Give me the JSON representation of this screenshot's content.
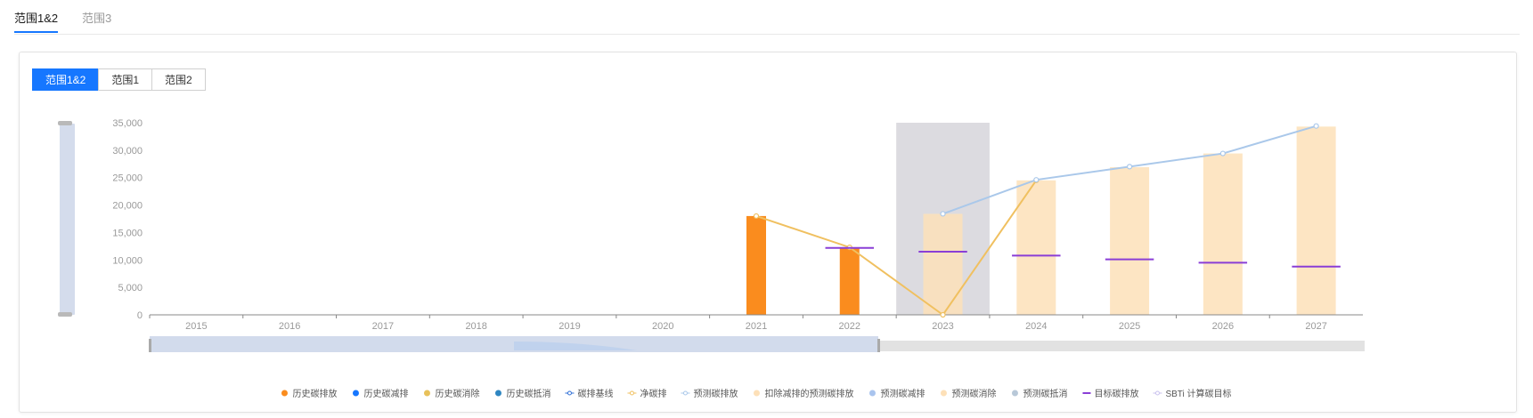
{
  "tabs": [
    {
      "label": "范围1&2",
      "active": true
    },
    {
      "label": "范围3",
      "active": false
    }
  ],
  "segment": [
    {
      "label": "范围1&2",
      "active": true
    },
    {
      "label": "范围1",
      "active": false
    },
    {
      "label": "范围2",
      "active": false
    }
  ],
  "chart_data": {
    "type": "bar",
    "categories": [
      "2015",
      "2016",
      "2017",
      "2018",
      "2019",
      "2020",
      "2021",
      "2022",
      "2023",
      "2024",
      "2025",
      "2026",
      "2027"
    ],
    "ylim": [
      0,
      35000
    ],
    "yticks": [
      "35,000",
      "30,000",
      "25,000",
      "20,000",
      "15,000",
      "10,000",
      "5,000",
      "0"
    ],
    "ytick_values": [
      35000,
      30000,
      25000,
      20000,
      15000,
      10000,
      5000,
      0
    ],
    "highlight_category": "2023",
    "series": [
      {
        "name": "历史碳排放",
        "kind": "bar",
        "color": "#fa8c1e",
        "values": [
          null,
          null,
          null,
          null,
          null,
          null,
          18000,
          12300,
          null,
          null,
          null,
          null,
          null
        ]
      },
      {
        "name": "历史碳减排",
        "kind": "bar",
        "color": "#1677ff",
        "values": [
          null,
          null,
          null,
          null,
          null,
          null,
          null,
          null,
          null,
          null,
          null,
          null,
          null
        ]
      },
      {
        "name": "历史碳消除",
        "kind": "bar",
        "color": "#e8c15a",
        "values": [
          null,
          null,
          null,
          null,
          null,
          null,
          null,
          null,
          null,
          null,
          null,
          null,
          null
        ]
      },
      {
        "name": "历史碳抵消",
        "kind": "bar",
        "color": "#2e86c1",
        "values": [
          null,
          null,
          null,
          null,
          null,
          null,
          null,
          null,
          null,
          null,
          null,
          null,
          null
        ]
      },
      {
        "name": "碳排基线",
        "kind": "line",
        "color": "#2f6fd6",
        "values": [
          null,
          null,
          null,
          null,
          null,
          null,
          null,
          null,
          null,
          null,
          null,
          null,
          null
        ]
      },
      {
        "name": "净碳排",
        "kind": "line",
        "color": "#f0c060",
        "values": [
          null,
          null,
          null,
          null,
          null,
          null,
          18000,
          12300,
          0,
          24500,
          null,
          null,
          null
        ]
      },
      {
        "name": "预测碳排放",
        "kind": "line",
        "color": "#aac8ea",
        "values": [
          null,
          null,
          null,
          null,
          null,
          null,
          null,
          null,
          18400,
          24600,
          27000,
          29400,
          34400
        ]
      },
      {
        "name": "扣除减排的预测碳排放",
        "kind": "bar",
        "color": "#fde0b8",
        "values": [
          null,
          null,
          null,
          null,
          null,
          null,
          null,
          null,
          18400,
          24500,
          26900,
          29400,
          34300
        ]
      },
      {
        "name": "预测碳减排",
        "kind": "bar",
        "color": "#a9c4ee",
        "values": [
          null,
          null,
          null,
          null,
          null,
          null,
          null,
          null,
          null,
          null,
          null,
          null,
          null
        ]
      },
      {
        "name": "预测碳消除",
        "kind": "bar",
        "color": "#fde0b8",
        "values": [
          null,
          null,
          null,
          null,
          null,
          null,
          null,
          null,
          null,
          null,
          null,
          null,
          null
        ]
      },
      {
        "name": "预测碳抵消",
        "kind": "bar",
        "color": "#b8c8d8",
        "values": [
          null,
          null,
          null,
          null,
          null,
          null,
          null,
          null,
          null,
          null,
          null,
          null,
          null
        ]
      },
      {
        "name": "目标碳排放",
        "kind": "dash",
        "color": "#8a3ed6",
        "values": [
          null,
          null,
          null,
          null,
          null,
          null,
          null,
          12200,
          11500,
          10800,
          10100,
          9500,
          8800
        ]
      },
      {
        "name": "SBTi 计算碳目标",
        "kind": "line",
        "color": "#c9c2ee",
        "values": [
          null,
          null,
          null,
          null,
          null,
          null,
          null,
          null,
          null,
          null,
          null,
          null,
          null
        ]
      }
    ],
    "legend_position": "bottom"
  }
}
